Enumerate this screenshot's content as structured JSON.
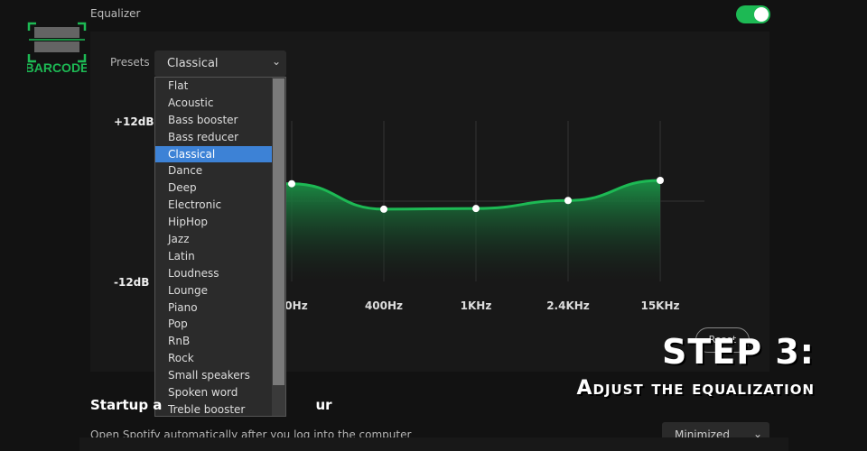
{
  "logo": {
    "text": "BARCODE",
    "color": "#1db954"
  },
  "equalizer": {
    "title": "Equalizer",
    "enabled": true,
    "accent": "#1db954"
  },
  "presets": {
    "label": "Presets",
    "selected": "Classical",
    "options": [
      "Flat",
      "Acoustic",
      "Bass booster",
      "Bass reducer",
      "Classical",
      "Dance",
      "Deep",
      "Electronic",
      "HipHop",
      "Jazz",
      "Latin",
      "Loudness",
      "Lounge",
      "Piano",
      "Pop",
      "RnB",
      "Rock",
      "Small speakers",
      "Spoken word",
      "Treble booster"
    ]
  },
  "chart_data": {
    "type": "area",
    "y_top_label": "+12dB",
    "y_bottom_label": "-12dB",
    "ylim": [
      -12,
      12
    ],
    "categories": [
      "60Hz",
      "150Hz",
      "400Hz",
      "1KHz",
      "2.4KHz",
      "15KHz"
    ],
    "visible_labels": [
      "0Hz",
      "400Hz",
      "1KHz",
      "2.4KHz",
      "15KHz"
    ],
    "values": [
      3,
      2.6,
      -1.2,
      -1.1,
      0.1,
      3.1
    ],
    "color": "#1db954",
    "grid": true
  },
  "reset": {
    "label": "Reset"
  },
  "startup": {
    "title": "Startup and window behaviour",
    "title_visible": "Startup a",
    "title_tail": "ur",
    "desc": "Open Spotify automatically after you log into the computer",
    "select": "Minimized"
  },
  "overlay": {
    "step": "STEP 3:",
    "subtitle": "Adjust the equalization"
  }
}
